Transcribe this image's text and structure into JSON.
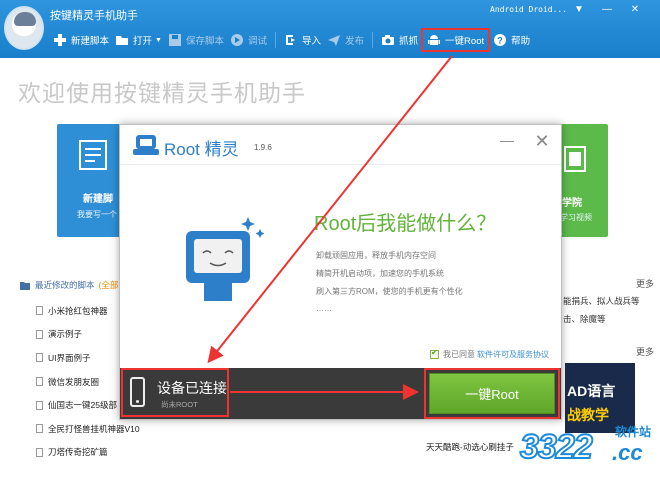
{
  "app": {
    "title": "按键精灵手机助手",
    "device": "Android Droid..."
  },
  "window_controls": {
    "dropdown": "▼",
    "minimize": "—",
    "close": "✕"
  },
  "toolbar": {
    "new_script": "新建脚本",
    "open": "打开",
    "save_script": "保存脚本",
    "debug": "调试",
    "import": "导入",
    "publish": "发布",
    "capture": "抓抓",
    "one_click_root": "一键Root",
    "help": "帮助"
  },
  "main": {
    "welcome": "欢迎使用按键精灵手机助手",
    "card_new_title": "新建脚",
    "card_new_sub": "我要写一个",
    "card_school_title": "学院",
    "card_school_sub": "学习视频",
    "recent_header": "最近修改的脚本",
    "recent_header_tag": "(全部",
    "recent_items": [
      "小米抢红包神器",
      "演示例子",
      "UI界面例子",
      "微信发朋友圈",
      "仙国志一键25级部",
      "全民打怪兽挂机神器V10",
      "刀塔传奇挖矿篇"
    ],
    "more_1": "更多",
    "side_line_1": "能捐兵、拟人战兵等",
    "side_line_2": "击、除魔等",
    "more_2": "更多",
    "ad_line_1": "AD语言",
    "ad_line_2": "战教学",
    "news_text": "天天酷跑-动选心刷挂子"
  },
  "dialog": {
    "brand": "Root 精灵",
    "version": "1.9.6",
    "minimize": "—",
    "close": "✕",
    "heading": "Root后我能做什么？",
    "features": [
      "卸载顽固应用，释放手机内存空间",
      "精简开机启动项，加速您的手机系统",
      "刷入第三方ROM，使您的手机更有个性化",
      "……"
    ],
    "agree_text": "我已同意",
    "agree_link": "软件许可及服务协议",
    "device_status": "设备已连接",
    "device_sub": "尚未ROOT",
    "root_button": "一键Root"
  },
  "watermark": {
    "number": "3322",
    "domain": ".cc",
    "tag": "软件站"
  },
  "colors": {
    "titlebar": "#1a7fcb",
    "accent_green": "#62b33a",
    "annotation_red": "#ee3333",
    "footer_dark": "#3a3a3a"
  }
}
